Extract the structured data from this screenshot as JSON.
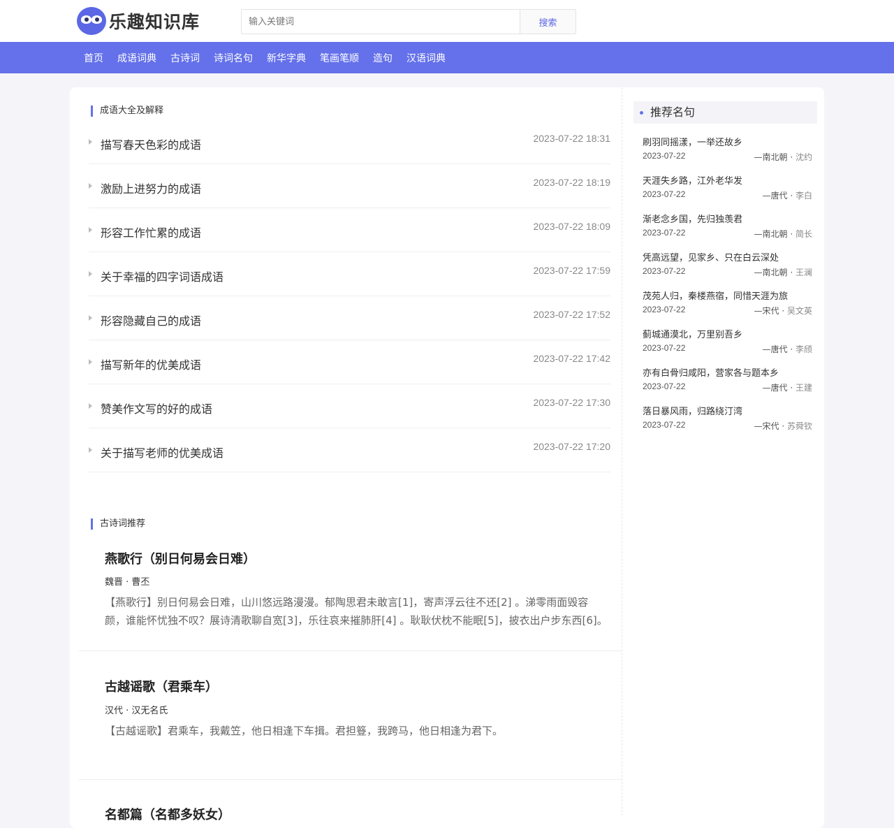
{
  "site": {
    "name": "乐趣知识库"
  },
  "search": {
    "placeholder": "输入关键词",
    "button": "搜索"
  },
  "nav": [
    "首页",
    "成语词典",
    "古诗词",
    "诗词名句",
    "新华字典",
    "笔画笔顺",
    "造句",
    "汉语词典"
  ],
  "idioms": {
    "section_title": "成语大全及解释",
    "items": [
      {
        "title": "描写春天色彩的成语",
        "time": "2023-07-22 18:31"
      },
      {
        "title": "激励上进努力的成语",
        "time": "2023-07-22 18:19"
      },
      {
        "title": "形容工作忙累的成语",
        "time": "2023-07-22 18:09"
      },
      {
        "title": "关于幸福的四字词语成语",
        "time": "2023-07-22 17:59"
      },
      {
        "title": "形容隐藏自己的成语",
        "time": "2023-07-22 17:52"
      },
      {
        "title": "描写新年的优美成语",
        "time": "2023-07-22 17:42"
      },
      {
        "title": "赞美作文写的好的成语",
        "time": "2023-07-22 17:30"
      },
      {
        "title": "关于描写老师的优美成语",
        "time": "2023-07-22 17:20"
      }
    ]
  },
  "poems": {
    "section_title": "古诗词推荐",
    "items": [
      {
        "title": "燕歌行（别日何易会日难）",
        "author": "魏晋 · 曹丕",
        "text": "【燕歌行】别日何易会日难，山川悠远路漫漫。郁陶思君未敢言[1]，寄声浮云往不还[2] 。涕零雨面毁容颜，谁能怀忧独不叹？展诗清歌聊自宽[3]，乐往哀来摧肺肝[4] 。耿耿伏枕不能眠[5]，披衣出户步东西[6]。"
      },
      {
        "title": "古越谣歌（君乘车）",
        "author": "汉代 · 汉无名氏",
        "text": "【古越谣歌】君乘车，我戴笠，他日相逢下车揖。君担簦，我跨马，他日相逢为君下。"
      },
      {
        "title": "名都篇（名都多妖女）",
        "author": "",
        "text": ""
      }
    ]
  },
  "sidebar": {
    "title": "推荐名句",
    "quotes": [
      {
        "text": "刷羽同摇漾，一举还故乡",
        "date": "2023-07-22",
        "dynasty": "—南北朝",
        "author": "沈约"
      },
      {
        "text": "天涯失乡路，江外老华发",
        "date": "2023-07-22",
        "dynasty": "—唐代",
        "author": "李白"
      },
      {
        "text": "渐老念乡国，先归独羡君",
        "date": "2023-07-22",
        "dynasty": "—南北朝",
        "author": "简长"
      },
      {
        "text": "凭高远望，见家乡、只在白云深处",
        "date": "2023-07-22",
        "dynasty": "—南北朝",
        "author": "王澜"
      },
      {
        "text": "茂苑人归，秦楼燕宿，同惜天涯为旅",
        "date": "2023-07-22",
        "dynasty": "—宋代",
        "author": "吴文英"
      },
      {
        "text": "蓟城通漠北，万里别吾乡",
        "date": "2023-07-22",
        "dynasty": "—唐代",
        "author": "李颀"
      },
      {
        "text": "亦有白骨归咸阳，营家各与题本乡",
        "date": "2023-07-22",
        "dynasty": "—唐代",
        "author": "王建"
      },
      {
        "text": "落日暴风雨，归路绕汀湾",
        "date": "2023-07-22",
        "dynasty": "—宋代",
        "author": "苏舜钦"
      }
    ]
  },
  "colors": {
    "accent": "#6471ea",
    "logo": "#5b67e4"
  }
}
